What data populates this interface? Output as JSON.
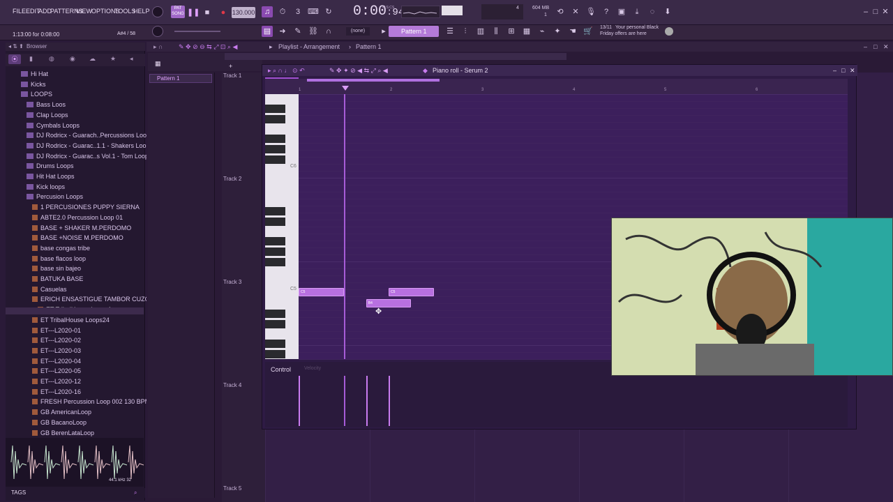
{
  "menu": [
    "FILE",
    "EDIT",
    "ADD",
    "PATTERNS",
    "VIEW",
    "OPTIONS",
    "TOOLS",
    "HELP"
  ],
  "transport": {
    "tempo": "130.000",
    "time": "0:00",
    "time_frac": "94",
    "time_unit": "M:S:CS",
    "cpu": "4",
    "memory": "604 MB",
    "memory_sub": "1"
  },
  "hint_bar": {
    "left": "1:13:00 for 0:08:00",
    "right": "A#4 / 58"
  },
  "toolbar2": {
    "snap": "(none)",
    "pattern": "Pattern 1"
  },
  "news": {
    "counter": "13/11",
    "text_line1": "Your personal Black",
    "text_line2": "Friday offers are here"
  },
  "browser": {
    "header": "Browser",
    "items": [
      {
        "label": "Hi Hat",
        "kind": "folder",
        "indent": 1
      },
      {
        "label": "Kicks",
        "kind": "folder",
        "indent": 1
      },
      {
        "label": "LOOPS",
        "kind": "folder",
        "indent": 1
      },
      {
        "label": "Bass Loos",
        "kind": "folder",
        "indent": 2
      },
      {
        "label": "Clap Loops",
        "kind": "folder",
        "indent": 2
      },
      {
        "label": "Cymbals Loops",
        "kind": "folder",
        "indent": 2
      },
      {
        "label": "DJ Rodricx - Guarach..Percussions Loops",
        "kind": "folder",
        "indent": 2
      },
      {
        "label": "DJ Rodricx - Guarac..1.1 - Shakers Loops",
        "kind": "folder",
        "indent": 2
      },
      {
        "label": "DJ Rodricx - Guarac..s Vol.1 - Tom Loops",
        "kind": "folder",
        "indent": 2
      },
      {
        "label": "Drums Loops",
        "kind": "folder",
        "indent": 2
      },
      {
        "label": "Hit Hat Loops",
        "kind": "folder",
        "indent": 2
      },
      {
        "label": "Kick loops",
        "kind": "folder",
        "indent": 2
      },
      {
        "label": "Percusion Loops",
        "kind": "folder",
        "indent": 2
      },
      {
        "label": "1 PERCUSIONES PUPPY SIERNA",
        "kind": "file",
        "indent": 3
      },
      {
        "label": "ABTE2.0 Percussion Loop 01",
        "kind": "file",
        "indent": 3
      },
      {
        "label": "BASE + SHAKER M.PERDOMO",
        "kind": "file",
        "indent": 3
      },
      {
        "label": "BASE +NOISE M.PERDOMO",
        "kind": "file",
        "indent": 3
      },
      {
        "label": "base congas tribe",
        "kind": "file",
        "indent": 3
      },
      {
        "label": "base flacos loop",
        "kind": "file",
        "indent": 3
      },
      {
        "label": "base sin bajeo",
        "kind": "file",
        "indent": 3
      },
      {
        "label": "BATUKA BASE",
        "kind": "file",
        "indent": 3
      },
      {
        "label": "Casuelas",
        "kind": "file",
        "indent": 3
      },
      {
        "label": "ERICH ENSASTIGUE TAMBOR CUZCA 1",
        "kind": "file",
        "indent": 3
      },
      {
        "label": "ET TribalHouse Loops1",
        "kind": "file",
        "indent": 4,
        "selected": true
      },
      {
        "label": "ET TribalHouse Loops24",
        "kind": "file",
        "indent": 3
      },
      {
        "label": "ET---L2020-01",
        "kind": "file",
        "indent": 3
      },
      {
        "label": "ET---L2020-02",
        "kind": "file",
        "indent": 3
      },
      {
        "label": "ET---L2020-03",
        "kind": "file",
        "indent": 3
      },
      {
        "label": "ET---L2020-04",
        "kind": "file",
        "indent": 3
      },
      {
        "label": "ET---L2020-05",
        "kind": "file",
        "indent": 3
      },
      {
        "label": "ET---L2020-12",
        "kind": "file",
        "indent": 3
      },
      {
        "label": "ET---L2020-16",
        "kind": "file",
        "indent": 3
      },
      {
        "label": "FRESH Percussion Loop 002 130 BPM",
        "kind": "file",
        "indent": 3
      },
      {
        "label": "GB AmericanLoop",
        "kind": "file",
        "indent": 3
      },
      {
        "label": "GB BacanoLoop",
        "kind": "file",
        "indent": 3
      },
      {
        "label": "GB BerenLataLoop",
        "kind": "file",
        "indent": 3
      }
    ],
    "sample_info": "44.1 kHz 32",
    "tags_label": "TAGS"
  },
  "playlist": {
    "title": "Playlist - Arrangement",
    "pattern_crumb": "Pattern 1",
    "pattern_item": "Pattern 1",
    "tracks": [
      "Track 1",
      "Track 2",
      "Track 3",
      "Track 4",
      "Track 5"
    ]
  },
  "pianoroll": {
    "title": "Piano roll - Serum 2",
    "ruler": [
      "1",
      "2",
      "3",
      "4",
      "5",
      "6"
    ],
    "key_labels": [
      "C6",
      "C5"
    ],
    "notes": [
      {
        "start_beat": 0.0,
        "length": 1.0,
        "label": "C5"
      },
      {
        "start_beat": 2.0,
        "length": 1.0,
        "label": "C5"
      },
      {
        "start_beat": 1.5,
        "length": 1.0,
        "label": "B4"
      }
    ],
    "control_label": "Control",
    "control_param": "Velocity"
  }
}
